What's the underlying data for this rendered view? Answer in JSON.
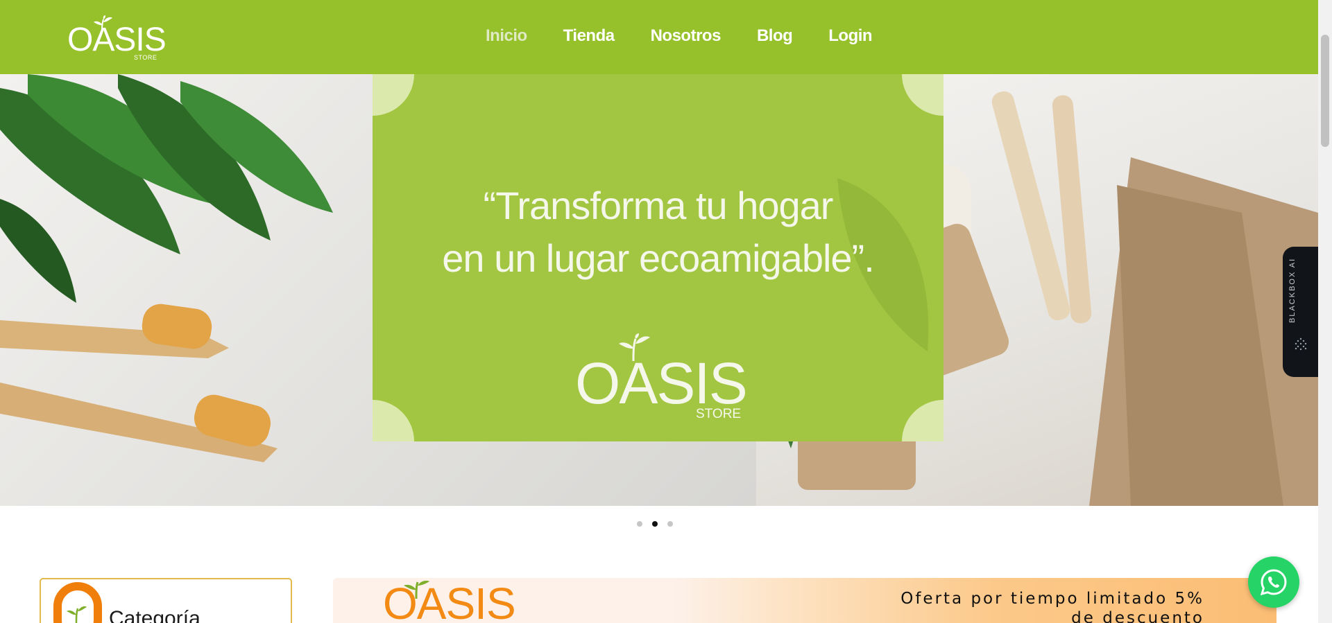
{
  "brand": {
    "name": "OASIS",
    "sub": "STORE",
    "primary_color": "#97c12a",
    "accent_color": "#f07e0a"
  },
  "nav": {
    "items": [
      {
        "label": "Inicio",
        "active": true
      },
      {
        "label": "Tienda",
        "active": false
      },
      {
        "label": "Nosotros",
        "active": false
      },
      {
        "label": "Blog",
        "active": false
      },
      {
        "label": "Login",
        "active": false
      }
    ]
  },
  "hero": {
    "quote_line1": "“Transforma tu hogar",
    "quote_line2": "en un lugar ecoamigable”.",
    "logo_text": "OASIS",
    "logo_sub": "STORE",
    "slides": 3,
    "active_slide": 2
  },
  "widget": {
    "label": "BLACKBOX AI",
    "icon": "blackbox-dots-icon"
  },
  "category": {
    "title": "Categoría"
  },
  "promo": {
    "logo_text": "OASIS",
    "text": "Oferta por tiempo limitado 5% de descuento"
  },
  "whatsapp": {
    "icon": "whatsapp-icon",
    "color": "#25d366"
  }
}
